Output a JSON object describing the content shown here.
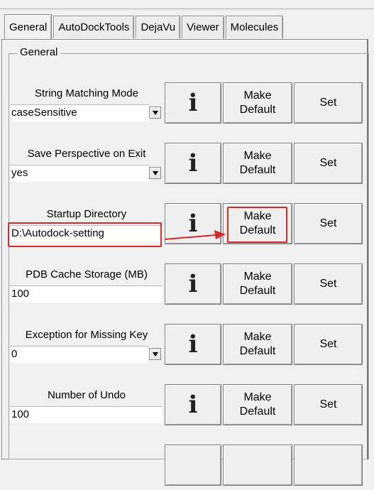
{
  "tabs": [
    {
      "label": "General",
      "active": true
    },
    {
      "label": "AutoDockTools",
      "active": false
    },
    {
      "label": "DejaVu",
      "active": false
    },
    {
      "label": "Viewer",
      "active": false
    },
    {
      "label": "Molecules",
      "active": false
    }
  ],
  "group": {
    "title": "General"
  },
  "buttons": {
    "info_icon": "info-icon",
    "make_default": "Make Default",
    "set": "Set"
  },
  "settings": [
    {
      "label": "String Matching Mode",
      "value": "caseSensitive",
      "control": "combobox"
    },
    {
      "label": "Save Perspective on Exit",
      "value": "yes",
      "control": "combobox"
    },
    {
      "label": "Startup Directory",
      "value": "D:\\Autodock-setting",
      "control": "text",
      "highlighted": true
    },
    {
      "label": "PDB Cache Storage (MB)",
      "value": "100",
      "control": "text"
    },
    {
      "label": "Exception for Missing Key",
      "value": "0",
      "control": "combobox"
    },
    {
      "label": "Number of Undo",
      "value": "100",
      "control": "text"
    }
  ],
  "annotation": {
    "color": "#d12b2b",
    "highlighted_button": "Make Default"
  }
}
